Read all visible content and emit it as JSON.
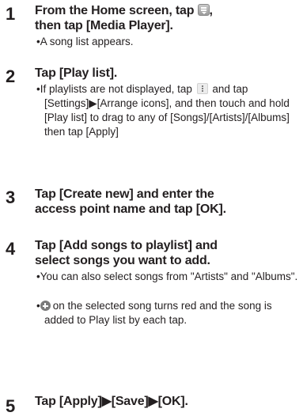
{
  "steps": [
    {
      "number": "1",
      "title_line1_before_icon": "From the Home screen, tap ",
      "title_line1_after_icon": ",",
      "title_line2": "then tap [Media Player].",
      "icon": "menu-key-icon",
      "bullets": [
        "A song list appears."
      ]
    },
    {
      "number": "2",
      "title": "Tap [Play list].",
      "icon": "kebab-menu-icon",
      "bullet_before_icon": "If playlists are not displayed, tap ",
      "bullet_after_icon": " and tap [Settings]▶[Arrange icons], and then touch and hold [Play list] to drag to any of [Songs]/[Artists]/[Albums] then tap [Apply]"
    },
    {
      "number": "3",
      "title_line1": "Tap [Create new] and enter the",
      "title_line2": "access point name and tap [OK]."
    },
    {
      "number": "4",
      "title_line1": "Tap [Add songs to playlist] and",
      "title_line2": "select songs you want to add.",
      "bullet1": "You can also select songs from \"Artists\" and \"Albums\".",
      "icon": "add-circle-icon",
      "bullet2_after_icon": "on the selected song turns red and the song is added to Play list by each tap."
    },
    {
      "number": "5",
      "title": "Tap [Apply]▶[Save]▶[OK]."
    }
  ],
  "bullet_char": "•"
}
